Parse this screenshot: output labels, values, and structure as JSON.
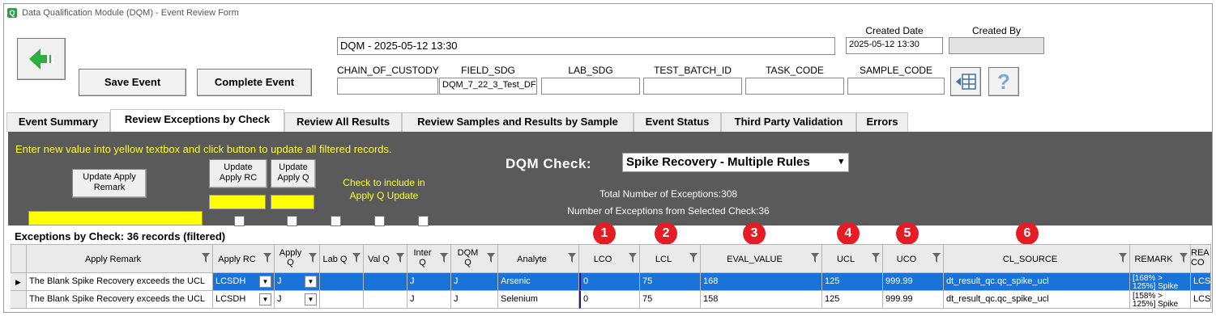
{
  "window": {
    "title": "Data Qualification Module (DQM) - Event Review Form",
    "app_icon_glyph": "Q",
    "accent": "#2e9e3e"
  },
  "header": {
    "event_name": "DQM - 2025-05-12 13:30",
    "created_date_label": "Created Date",
    "created_date_value": "2025-05-12 13:30",
    "created_by_label": "Created By",
    "created_by_value": "",
    "save_label": "Save Event",
    "complete_label": "Complete Event",
    "fields": [
      {
        "label": "CHAIN_OF_CUSTODY",
        "value": ""
      },
      {
        "label": "FIELD_SDG",
        "value": "DQM_7_22_3_Test_DF"
      },
      {
        "label": "LAB_SDG",
        "value": ""
      },
      {
        "label": "TEST_BATCH_ID",
        "value": ""
      },
      {
        "label": "TASK_CODE",
        "value": ""
      },
      {
        "label": "SAMPLE_CODE",
        "value": ""
      }
    ],
    "help_glyph": "?"
  },
  "tabs": [
    {
      "label": "Event Summary",
      "active": false
    },
    {
      "label": "Review Exceptions by Check",
      "active": true
    },
    {
      "label": "Review All Results",
      "active": false
    },
    {
      "label": "Review Samples and Results by Sample",
      "active": false
    },
    {
      "label": "Event Status",
      "active": false
    },
    {
      "label": "Third Party Validation",
      "active": false
    },
    {
      "label": "Errors",
      "active": false
    }
  ],
  "panel": {
    "instruction": "Enter new value into yellow textbox and click button to update all filtered records.",
    "update_remark_label": "Update Apply\nRemark",
    "update_rc_label": "Update\nApply RC",
    "update_q_label": "Update\nApply Q",
    "check_include_label": "Check to include in\nApply Q Update",
    "dqm_check_label": "DQM Check:",
    "dqm_check_value": "Spike Recovery - Multiple Rules",
    "total_exceptions": "Total Number of Exceptions:308",
    "selected_exceptions": "Number of Exceptions from Selected Check:36"
  },
  "grid": {
    "records_caption": "Exceptions by Check: 36 records (filtered)",
    "columns": [
      "Apply Remark",
      "Apply RC",
      "Apply\nQ",
      "Lab Q",
      "Val Q",
      "Inter\nQ",
      "DQM\nQ",
      "Analyte",
      "LCO",
      "LCL",
      "EVAL_VALUE",
      "UCL",
      "UCO",
      "CL_SOURCE",
      "REMARK",
      "REA\nCO"
    ],
    "rows": [
      {
        "remark": "The Blank Spike Recovery exceeds the UCL",
        "rc": "LCSDH",
        "q": "J",
        "lab_q": "",
        "val_q": "",
        "inter_q": "J",
        "dqm_q": "J",
        "analyte": "Arsenic",
        "lco": "0",
        "lcl": "75",
        "eval": "168",
        "ucl": "125",
        "uco": "999.99",
        "cl_source": "dt_result_qc.qc_spike_ucl",
        "remark2": "[168% >\n125%] Spike",
        "rea": "LCS"
      },
      {
        "remark": "The Blank Spike Recovery exceeds the UCL",
        "rc": "LCSDH",
        "q": "J",
        "lab_q": "",
        "val_q": "",
        "inter_q": "J",
        "dqm_q": "J",
        "analyte": "Selenium",
        "lco": "0",
        "lcl": "75",
        "eval": "158",
        "ucl": "125",
        "uco": "999.99",
        "cl_source": "dt_result_qc.qc_spike_ucl",
        "remark2": "[158% >\n125%] Spike",
        "rea": "LCS"
      }
    ]
  },
  "badges": [
    "1",
    "2",
    "3",
    "4",
    "5",
    "6"
  ]
}
